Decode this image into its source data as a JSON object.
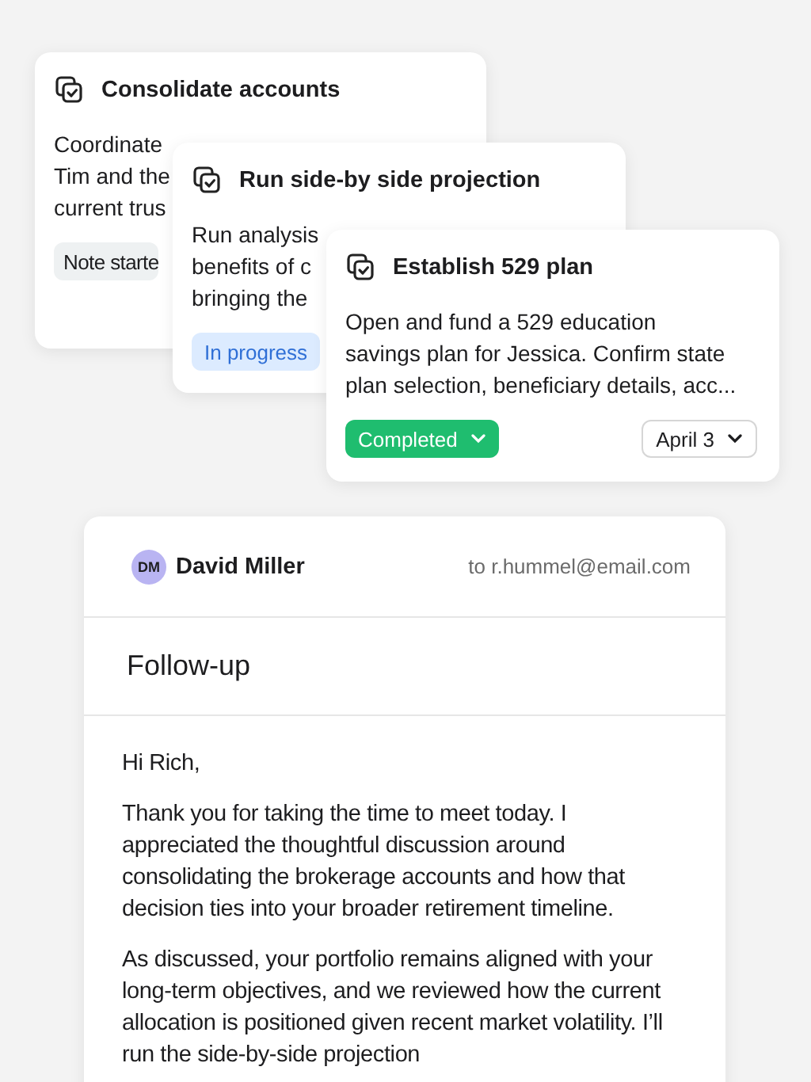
{
  "tasks": [
    {
      "title": "Consolidate accounts",
      "body_lines": [
        "Coordinate",
        "Tim and the",
        "current trus"
      ],
      "status": {
        "kind": "note",
        "label": "Note starte",
        "chevron": false
      }
    },
    {
      "title": "Run side-by side projection",
      "body_lines": [
        "Run analysis",
        "benefits of c",
        "bringing the"
      ],
      "status": {
        "kind": "in_progress",
        "label": "In progress",
        "chevron": false
      }
    },
    {
      "title": "Establish 529 plan",
      "body_lines": [
        "Open and fund a 529 education",
        "savings plan for Jessica. Confirm state",
        "plan selection, beneficiary details, acc..."
      ],
      "status": {
        "kind": "completed",
        "label": "Completed",
        "chevron": true
      },
      "due": "April 3"
    }
  ],
  "email": {
    "sender_initials": "DM",
    "sender": "David Miller",
    "recipient": "to r.hummel@email.com",
    "subject": "Follow-up",
    "paragraphs": [
      "Hi Rich,",
      "Thank you for taking the time to meet today. I appreciated the thoughtful discussion around consolidating the brokerage accounts and how that decision ties into your broader retirement timeline.",
      "As discussed, your portfolio remains aligned with your long-term objectives, and we reviewed how the current allocation is positioned given recent market volatility. I’ll run the side-by-side projection"
    ]
  }
}
